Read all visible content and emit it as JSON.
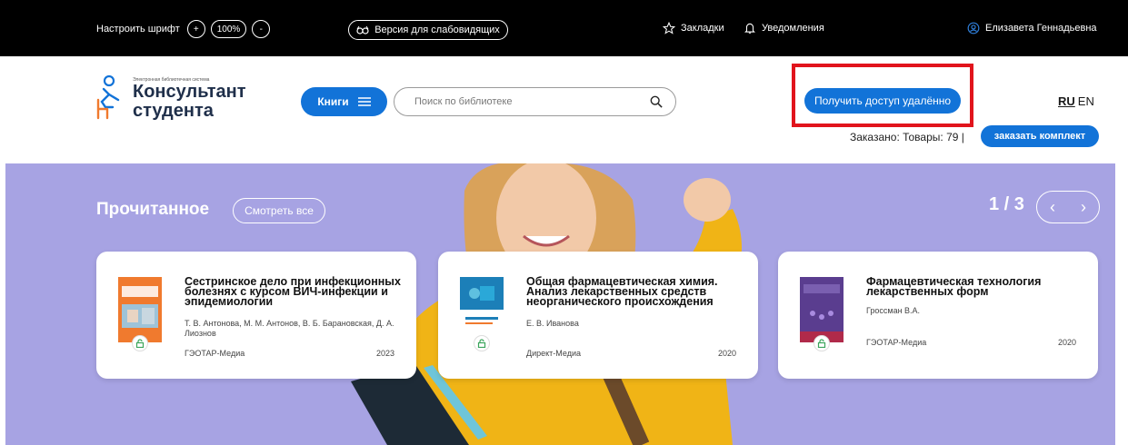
{
  "topbar": {
    "font_label": "Настроить шрифт",
    "font_plus": "+",
    "font_zoom": "100%",
    "font_minus": "-",
    "vision_label": "Версия для слабовидящих",
    "bookmarks_label": "Закладки",
    "notifications_label": "Уведомления",
    "user_name": "Елизавета Геннадьевна"
  },
  "header": {
    "logo_tagline": "Электронная библиотечная система",
    "logo_line1": "Консультант",
    "logo_line2": "студента",
    "books_button": "Книги",
    "search_placeholder": "Поиск по библиотеке",
    "remote_access_button": "Получить доступ удалённо",
    "lang_ru": "RU",
    "lang_en": "EN",
    "ordered_text": "Заказано:  Товары: 79 |",
    "order_kit_button": "заказать комплект"
  },
  "hero": {
    "section_title": "Прочитанное",
    "see_all_button": "Смотреть все",
    "pager": "1 / 3",
    "prev_arrow": "‹",
    "next_arrow": "›"
  },
  "books": [
    {
      "title": "Сестринское дело при инфекционных болезнях с курсом ВИЧ-инфекции и эпидемиологии",
      "authors": "Т. В. Антонова, М. М. Антонов, В. Б. Барановская, Д. А. Лиознов",
      "publisher": "ГЭОТАР-Медиа",
      "year": "2023",
      "cover_color": "#f07a2e"
    },
    {
      "title": "Общая фармацевтическая химия. Анализ лекарственных средств неорганического происхождения",
      "authors": "Е. В. Иванова",
      "publisher": "Директ-Медиа",
      "year": "2020",
      "cover_color": "#1c7fb8"
    },
    {
      "title": "Фармацевтическая технология лекарственных форм",
      "authors": "Гроссман В.А.",
      "publisher": "ГЭОТАР-Медиа",
      "year": "2020",
      "cover_color": "#5a3d8f"
    }
  ]
}
